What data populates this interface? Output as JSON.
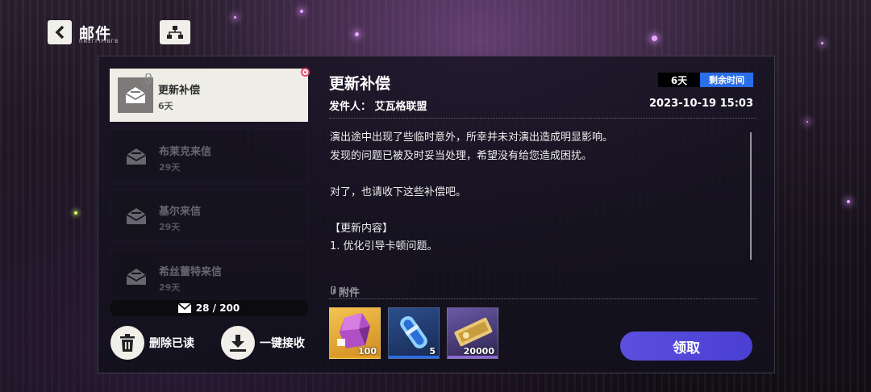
{
  "header": {
    "title": "邮件",
    "subtitle": "ΠΝΣΓΓΙΡΙΒΓΒ"
  },
  "mails": [
    {
      "title": "更新补偿",
      "days": "6天",
      "selected": true
    },
    {
      "title": "布莱克来信",
      "days": "29天"
    },
    {
      "title": "基尔来信",
      "days": "29天"
    },
    {
      "title": "希丝蕾特来信",
      "days": "29天"
    }
  ],
  "mail_count": "28 / 200",
  "actions": {
    "delete_read": "删除已读",
    "receive_all": "一键接收"
  },
  "detail": {
    "title": "更新补偿",
    "days_badge": "6天",
    "remain_label": "剩余时间",
    "sender": "发件人：   艾瓦格联盟",
    "date": "2023-10-19 15:03",
    "body": [
      "演出途中出现了些临时意外，所幸并未对演出造成明显影响。",
      "发现的问题已被及时妥当处理，希望没有给您造成困扰。",
      "",
      "对了，也请收下这些补偿吧。",
      "",
      "【更新内容】",
      "1. 优化引导卡顿问题。"
    ],
    "attachments_label": "附件",
    "attachments": [
      {
        "icon": "crystal-cube-icon",
        "quantity": "100",
        "color": "#e0a020"
      },
      {
        "icon": "energy-capsule-icon",
        "quantity": "5",
        "color": "#2a6ee8"
      },
      {
        "icon": "gold-ticket-icon",
        "quantity": "20000",
        "color": "#8a6ad0"
      }
    ],
    "claim_label": "领取"
  }
}
